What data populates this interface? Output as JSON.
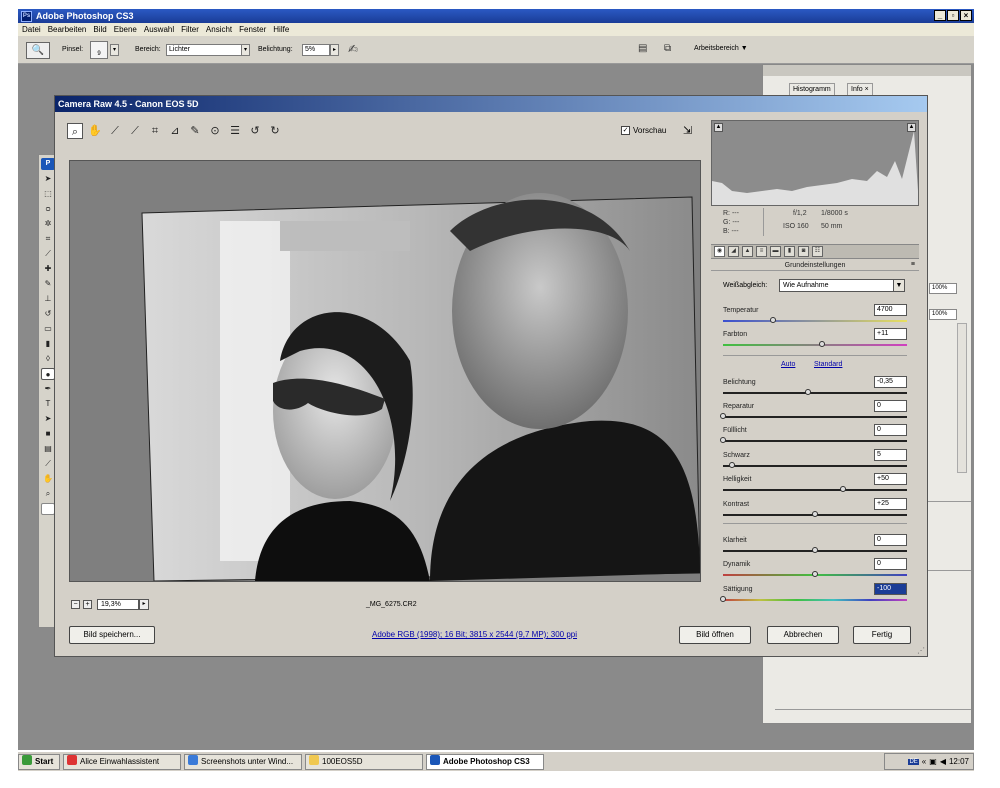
{
  "app": {
    "title": "Adobe Photoshop CS3",
    "logo_text": "Ps"
  },
  "menubar": [
    "Datei",
    "Bearbeiten",
    "Bild",
    "Ebene",
    "Auswahl",
    "Filter",
    "Ansicht",
    "Fenster",
    "Hilfe"
  ],
  "options_bar": {
    "brush_label": "Pinsel:",
    "brush_size": "9",
    "range_label": "Bereich:",
    "range_value": "Lichter",
    "exposure_label": "Belichtung:",
    "exposure_value": "5%",
    "workspace_label": "Arbeitsbereich"
  },
  "panels": {
    "histogram_tab": "Histogramm",
    "info_tab": "Info",
    "zoom_a": "100%",
    "zoom_b": "100%"
  },
  "camera_raw": {
    "title": "Camera Raw 4.5 - Canon EOS 5D",
    "preview_label": "Vorschau",
    "preview_checked": true,
    "zoom": "19,3%",
    "filename": "_MG_6275.CR2",
    "workflow_link": "Adobe RGB (1998); 16 Bit; 3815 x 2544 (9,7 MP); 300 ppi",
    "buttons": {
      "save": "Bild speichern...",
      "open": "Bild öffnen",
      "cancel": "Abbrechen",
      "done": "Fertig"
    },
    "info": {
      "r": "R:  ---",
      "g": "G:  ---",
      "b": "B:  ---",
      "aperture": "f/1,2",
      "shutter": "1/8000 s",
      "iso": "ISO 160",
      "focal": "50 mm"
    },
    "panel_title": "Grundeinstellungen",
    "white_balance_label": "Weißabgleich:",
    "white_balance_value": "Wie Aufnahme",
    "auto_link": "Auto",
    "standard_link": "Standard",
    "sliders": [
      {
        "label": "Temperatur",
        "value": "4700",
        "pos": 0.27
      },
      {
        "label": "Farbton",
        "value": "+11",
        "pos": 0.54
      },
      {
        "label": "Belichtung",
        "value": "-0,35",
        "pos": 0.46
      },
      {
        "label": "Reparatur",
        "value": "0",
        "pos": 0.0
      },
      {
        "label": "Fülllicht",
        "value": "0",
        "pos": 0.0
      },
      {
        "label": "Schwarz",
        "value": "5",
        "pos": 0.05
      },
      {
        "label": "Helligkeit",
        "value": "+50",
        "pos": 0.65
      },
      {
        "label": "Kontrast",
        "value": "+25",
        "pos": 0.5
      },
      {
        "label": "Klarheit",
        "value": "0",
        "pos": 0.5
      },
      {
        "label": "Dynamik",
        "value": "0",
        "pos": 0.5
      },
      {
        "label": "Sättigung",
        "value": "-100",
        "pos": 0.0
      }
    ]
  },
  "taskbar": {
    "start": "Start",
    "items": [
      "Alice Einwahlassistent",
      "Screenshots unter Wind...",
      "100EOS5D",
      "Adobe Photoshop CS3"
    ],
    "time": "12:07",
    "lang": "DE"
  }
}
